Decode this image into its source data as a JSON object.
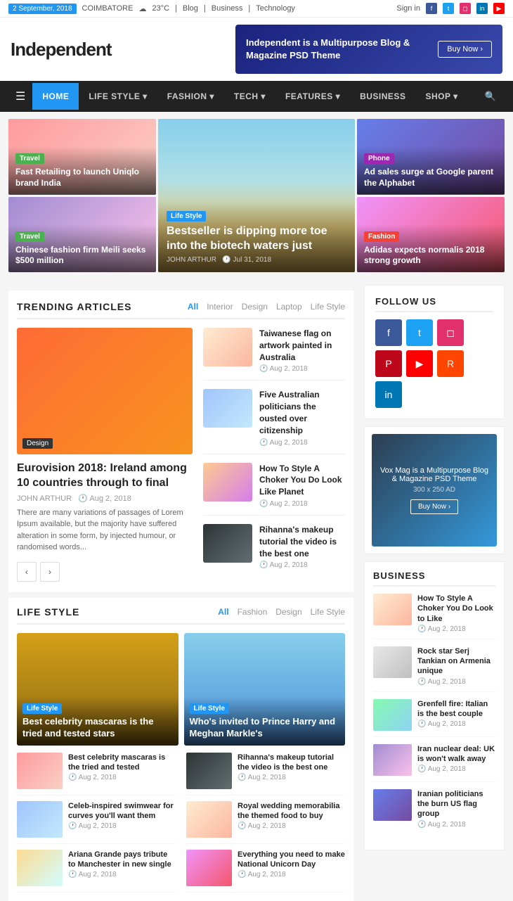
{
  "topbar": {
    "date": "2 September, 2018",
    "weather": "COIMBATORE",
    "temp": "23°C",
    "nav_items": [
      "Blog",
      "Business",
      "Technology"
    ],
    "signin": "Sign in"
  },
  "header": {
    "logo": "Independent",
    "banner_text": "Independent is a Multipurpose Blog & Magazine PSD Theme",
    "banner_btn": "Buy Now ›"
  },
  "navbar": {
    "items": [
      {
        "label": "HOME",
        "active": true
      },
      {
        "label": "LIFE STYLE",
        "has_dropdown": true
      },
      {
        "label": "FASHION",
        "has_dropdown": true
      },
      {
        "label": "TECH",
        "has_dropdown": true
      },
      {
        "label": "FEATURES",
        "has_dropdown": true
      },
      {
        "label": "BUSINESS",
        "has_dropdown": false
      },
      {
        "label": "SHOP",
        "has_dropdown": true
      }
    ]
  },
  "hero": {
    "card1": {
      "tag": "Travel",
      "title": "Fast Retailing to launch Uniqlo brand India"
    },
    "card2": {
      "tag": "Travel",
      "title": "Chinese fashion firm Meili seeks $500 million"
    },
    "center_tag": "Life Style",
    "center_title": "Bestseller is dipping more toe into the biotech waters just",
    "center_author": "JOHN ARTHUR",
    "center_date": "Jul 31, 2018",
    "card3": {
      "tag": "Phone",
      "title": "Ad sales surge at Google parent the Alphabet"
    },
    "card4": {
      "tag": "Fashion",
      "title": "Adidas expects normalis 2018 strong growth"
    }
  },
  "trending": {
    "title": "TRENDING ARTICLES",
    "tabs": [
      "All",
      "Interior",
      "Design",
      "Laptop",
      "Life Style"
    ],
    "main": {
      "tag": "Design",
      "title": "Eurovision 2018: Ireland among 10 countries through to final",
      "author": "JOHN ARTHUR",
      "date": "Aug 2, 2018",
      "text": "There are many variations of passages of Lorem Ipsum available, but the majority have suffered alteration in some form, by injected humour, or randomised words..."
    },
    "items": [
      {
        "title": "Taiwanese flag on artwork painted in Australia",
        "date": "Aug 2, 2018"
      },
      {
        "title": "Five Australian politicians the ousted over citizenship",
        "date": "Aug 2, 2018"
      },
      {
        "title": "How To Style A Choker You Do Look Like Planet",
        "date": "Aug 2, 2018"
      },
      {
        "title": "Rihanna's makeup tutorial the video is the best one",
        "date": "Aug 2, 2018"
      }
    ]
  },
  "lifestyle": {
    "title": "LIFE STYLE",
    "tabs": [
      "All",
      "Fashion",
      "Design",
      "Life Style"
    ],
    "featured": [
      {
        "tag": "Life Style",
        "title": "Best celebrity mascaras is the tried and tested stars"
      },
      {
        "tag": "Life Style",
        "title": "Who's invited to Prince Harry and Meghan Markle's"
      }
    ],
    "list": [
      {
        "title": "Best celebrity mascaras is the tried and tested",
        "date": "Aug 2, 2018"
      },
      {
        "title": "Rihanna's makeup tutorial the video is the best one",
        "date": "Aug 2, 2018"
      },
      {
        "title": "Celeb-inspired swimwear for curves you'll want them",
        "date": "Aug 2, 2018"
      },
      {
        "title": "Royal wedding memorabilia the themed food to buy",
        "date": "Aug 2, 2018"
      },
      {
        "title": "Ariana Grande pays tribute to Manchester in new single",
        "date": "Aug 2, 2018"
      },
      {
        "title": "Everything you need to make National Unicorn Day",
        "date": "Aug 2, 2018"
      }
    ]
  },
  "follow": {
    "title": "FOLLOW US"
  },
  "ad": {
    "text": "Vox Mag is a Multipurpose Blog & Magazine PSD Theme",
    "size": "300 x 250 AD",
    "btn": "Buy Now ›"
  },
  "business": {
    "title": "BUSINESS",
    "items": [
      {
        "title": "How To Style A Choker You Do Look to Like",
        "date": "Aug 2, 2018"
      },
      {
        "title": "Rock star Serj Tankian on Armenia unique",
        "date": "Aug 2, 2018"
      },
      {
        "title": "Grenfell fire: Italian is the best couple",
        "date": "Aug 2, 2018"
      },
      {
        "title": "Iran nuclear deal: UK is won't walk away",
        "date": "Aug 2, 2018"
      },
      {
        "title": "Iranian politicians the burn US flag group",
        "date": "Aug 2, 2018"
      }
    ]
  },
  "pagination": {
    "prev": "‹",
    "next": "›"
  }
}
